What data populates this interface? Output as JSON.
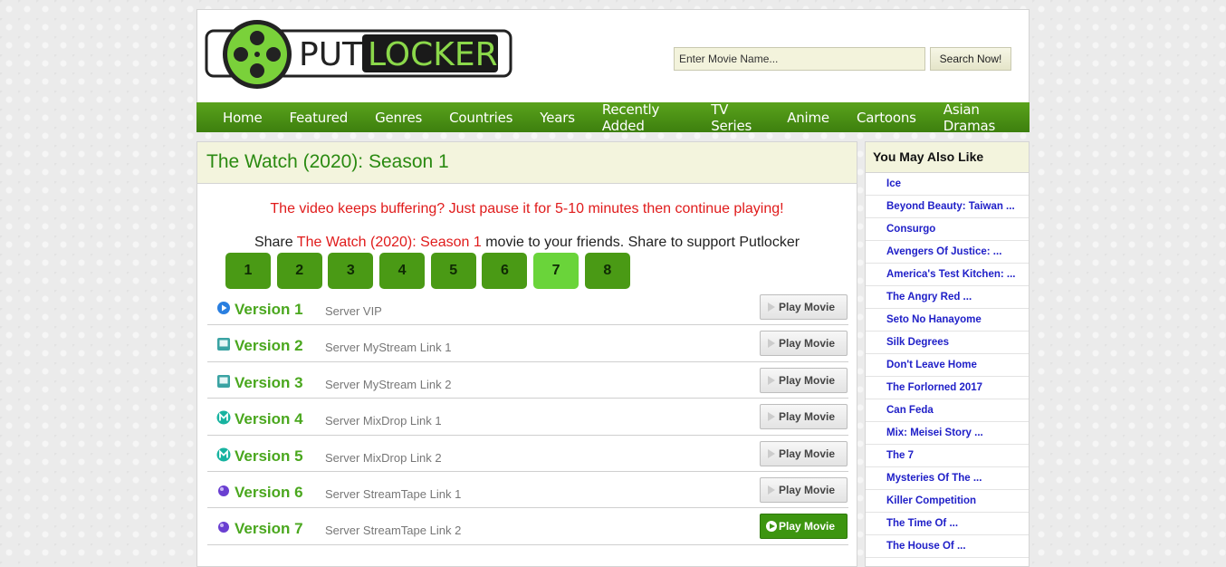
{
  "header": {
    "logo_text_put": "PUT",
    "logo_text_locker": "LOCKER",
    "search_placeholder": "Enter Movie Name...",
    "search_button": "Search Now!"
  },
  "nav": [
    "Home",
    "Featured",
    "Genres",
    "Countries",
    "Years",
    "Recently Added",
    "TV Series",
    "Anime",
    "Cartoons",
    "Asian Dramas"
  ],
  "main": {
    "title": "The Watch (2020): Season 1",
    "notice": "The video keeps buffering? Just pause it for 5-10 minutes then continue playing!",
    "share_prefix": "Share",
    "share_title": "The Watch (2020): Season 1",
    "share_suffix": "movie to your friends. Share to support Putlocker",
    "episodes": [
      "1",
      "2",
      "3",
      "4",
      "5",
      "6",
      "7",
      "8"
    ],
    "active_episode": "7",
    "versions": [
      {
        "label": "Version 1",
        "server": "Server VIP",
        "icon": "play-circle-icon",
        "button": "Play Movie"
      },
      {
        "label": "Version 2",
        "server": "Server MyStream Link 1",
        "icon": "mystream-icon",
        "button": "Play Movie"
      },
      {
        "label": "Version 3",
        "server": "Server MyStream Link 2",
        "icon": "mystream-icon",
        "button": "Play Movie"
      },
      {
        "label": "Version 4",
        "server": "Server MixDrop Link 1",
        "icon": "mixdrop-icon",
        "button": "Play Movie"
      },
      {
        "label": "Version 5",
        "server": "Server MixDrop Link 2",
        "icon": "mixdrop-icon",
        "button": "Play Movie"
      },
      {
        "label": "Version 6",
        "server": "Server StreamTape Link 1",
        "icon": "streamtape-icon",
        "button": "Play Movie"
      },
      {
        "label": "Version 7",
        "server": "Server StreamTape Link 2",
        "icon": "streamtape-icon",
        "button": "Play Movie"
      }
    ]
  },
  "sidebar": {
    "title": "You May Also Like",
    "items": [
      "Ice",
      "Beyond Beauty: Taiwan ...",
      "Consurgo",
      "Avengers Of Justice: ...",
      "America's Test Kitchen: ...",
      "The Angry Red ...",
      "Seto No Hanayome",
      "Silk Degrees",
      "Don't Leave Home",
      "The Forlorned 2017",
      "Can Feda",
      "Mix: Meisei Story ...",
      "The 7",
      "Mysteries Of The ...",
      "Killer Competition",
      "The Time Of ...",
      "The House Of ..."
    ]
  },
  "colors": {
    "accent_green": "#4aa71e",
    "nav_green": "#4b9215",
    "alert_red": "#e01b1b",
    "link_blue": "#2020c8"
  }
}
